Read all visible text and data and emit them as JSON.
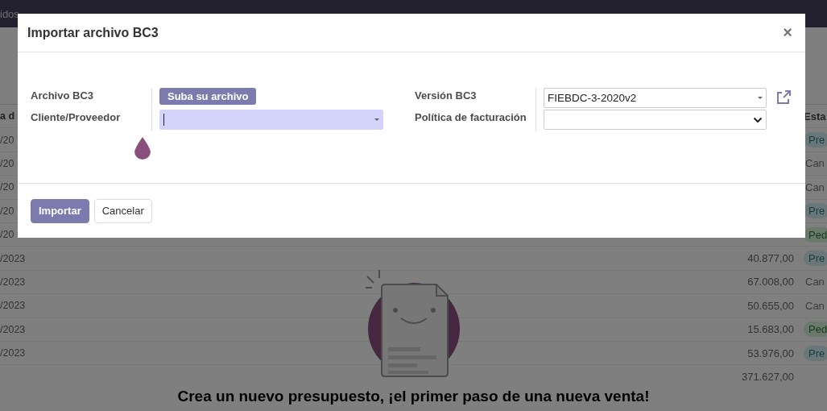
{
  "navbar": {
    "items": [
      {
        "label": "idos"
      }
    ]
  },
  "table": {
    "columns": [
      "a d",
      "Esta"
    ],
    "rows": [
      {
        "date": "/20",
        "status": "Pre",
        "kind": "info"
      },
      {
        "date": "/20",
        "status": "Can",
        "kind": "plain"
      },
      {
        "date": "/20",
        "status": "Can",
        "kind": "plain"
      },
      {
        "date": "/20",
        "status": "Pre",
        "kind": "info"
      },
      {
        "date": "/20",
        "status": "Ped",
        "kind": "success"
      },
      {
        "date": "/2023",
        "amount": "40.877,00",
        "status": "Pre",
        "kind": "info"
      },
      {
        "date": "/2023",
        "amount": "67.008,00",
        "status": "Can",
        "kind": "plain"
      },
      {
        "date": "/2023",
        "amount": "50.655,00",
        "status": "Can",
        "kind": "plain"
      },
      {
        "date": "/2023",
        "amount": "15.683,00",
        "status": "Ped",
        "kind": "success"
      },
      {
        "date": "/2023",
        "amount": "53.976,00",
        "status": "Pre",
        "kind": "info"
      }
    ],
    "total": "371.627,00"
  },
  "empty_state": {
    "message": "Crea un nuevo presupuesto, ¡el primer paso de una nueva venta!"
  },
  "dialog": {
    "title": "Importar archivo BC3",
    "close": "×",
    "left_fields": [
      {
        "label": "Archivo BC3",
        "kind": "upload",
        "button": "Suba su archivo"
      },
      {
        "label": "Cliente/Proveedor",
        "kind": "many2one",
        "focused": true
      }
    ],
    "right_fields": [
      {
        "label": "Versión BC3",
        "kind": "many2one",
        "value": "FIEBDC-3-2020v2",
        "focused": false
      },
      {
        "label": "Política de facturación",
        "kind": "select"
      }
    ],
    "buttons": [
      {
        "label": "Importar",
        "kind": "primary"
      },
      {
        "label": "Cancelar",
        "kind": "secondary"
      }
    ]
  }
}
